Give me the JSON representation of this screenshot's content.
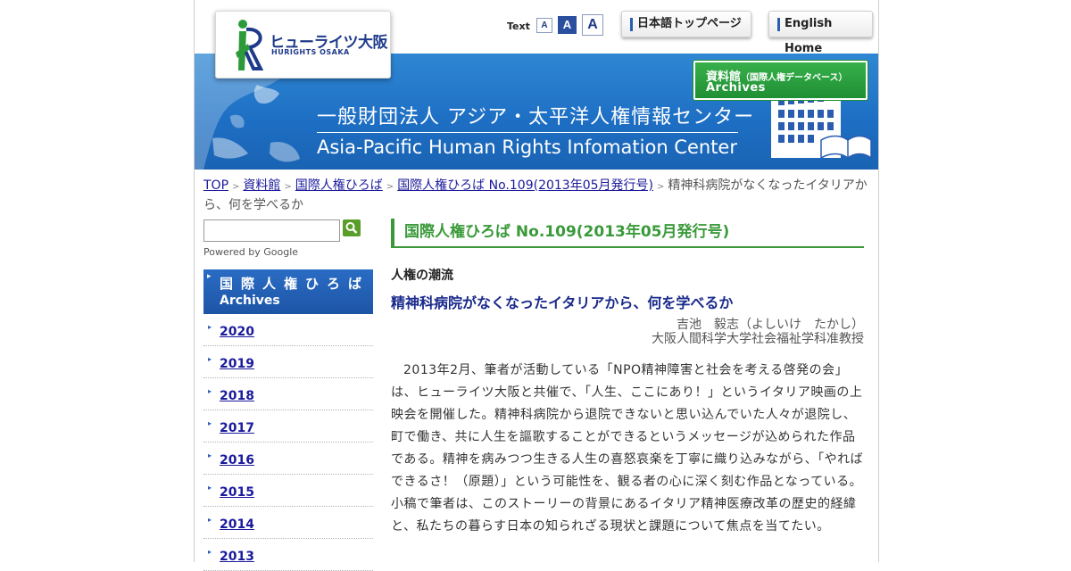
{
  "header": {
    "logo_ja": "ヒューライツ大阪",
    "logo_en": "HURIGHTS OSAKA",
    "text_size_label": "Text",
    "text_size_small": "A",
    "text_size_medium": "A",
    "text_size_large": "A",
    "nav_japanese_top": "日本語トップページ",
    "nav_english_home": "English Home",
    "banner_ja": "一般財団法人 アジア・太平洋人権情報センター",
    "banner_en": "Asia-Pacific Human Rights Infomation Center",
    "archives_ja": "資料館",
    "archives_ja_sub": "（国際人権データベース）",
    "archives_en": "Archives"
  },
  "breadcrumb": {
    "items": [
      "TOP",
      "資料館",
      "国際人権ひろば",
      "国際人権ひろば No.109(2013年05月発行号)"
    ],
    "current": "精神科病院がなくなったイタリアから、何を学べるか"
  },
  "search": {
    "placeholder": "",
    "powered_by": "Powered by Google"
  },
  "sidebar": {
    "title_ja": "国際人権ひろば",
    "title_en": "Archives",
    "years": [
      "2020",
      "2019",
      "2018",
      "2017",
      "2016",
      "2015",
      "2014",
      "2013"
    ]
  },
  "main": {
    "issue_heading": "国際人権ひろば No.109(2013年05月発行号)",
    "section_label": "人権の潮流",
    "article_title": "精神科病院がなくなったイタリアから、何を学べるか",
    "author_name": "吉池　毅志（よしいけ　たかし）",
    "author_affiliation": "大阪人間科学大学社会福祉学科准教授",
    "body": "2013年2月、筆者が活動している「NPO精神障害と社会を考える啓発の会」は、ヒューライツ大阪と共催で、「人生、ここにあり！」というイタリア映画の上映会を開催した。精神科病院から退院できないと思い込んでいた人々が退院し、町で働き、共に人生を謳歌することができるというメッセージが込められた作品である。精神を病みつつ生きる人生の喜怒哀楽を丁寧に織り込みながら、「やればできるさ！（原題）」という可能性を、観る者の心に深く刻む作品となっている。小稿で筆者は、このストーリーの背景にあるイタリア精神医療改革の歴史的経緯と、私たちの暮らす日本の知られざる現状と課題について焦点を当てたい。"
  },
  "colors": {
    "banner_blue": "#1d6ec3",
    "link_blue": "#1a1a9c",
    "heading_green": "#3a9a3a",
    "title_navy": "#1a2a8c",
    "sidebar_blue": "#1d55a6"
  }
}
